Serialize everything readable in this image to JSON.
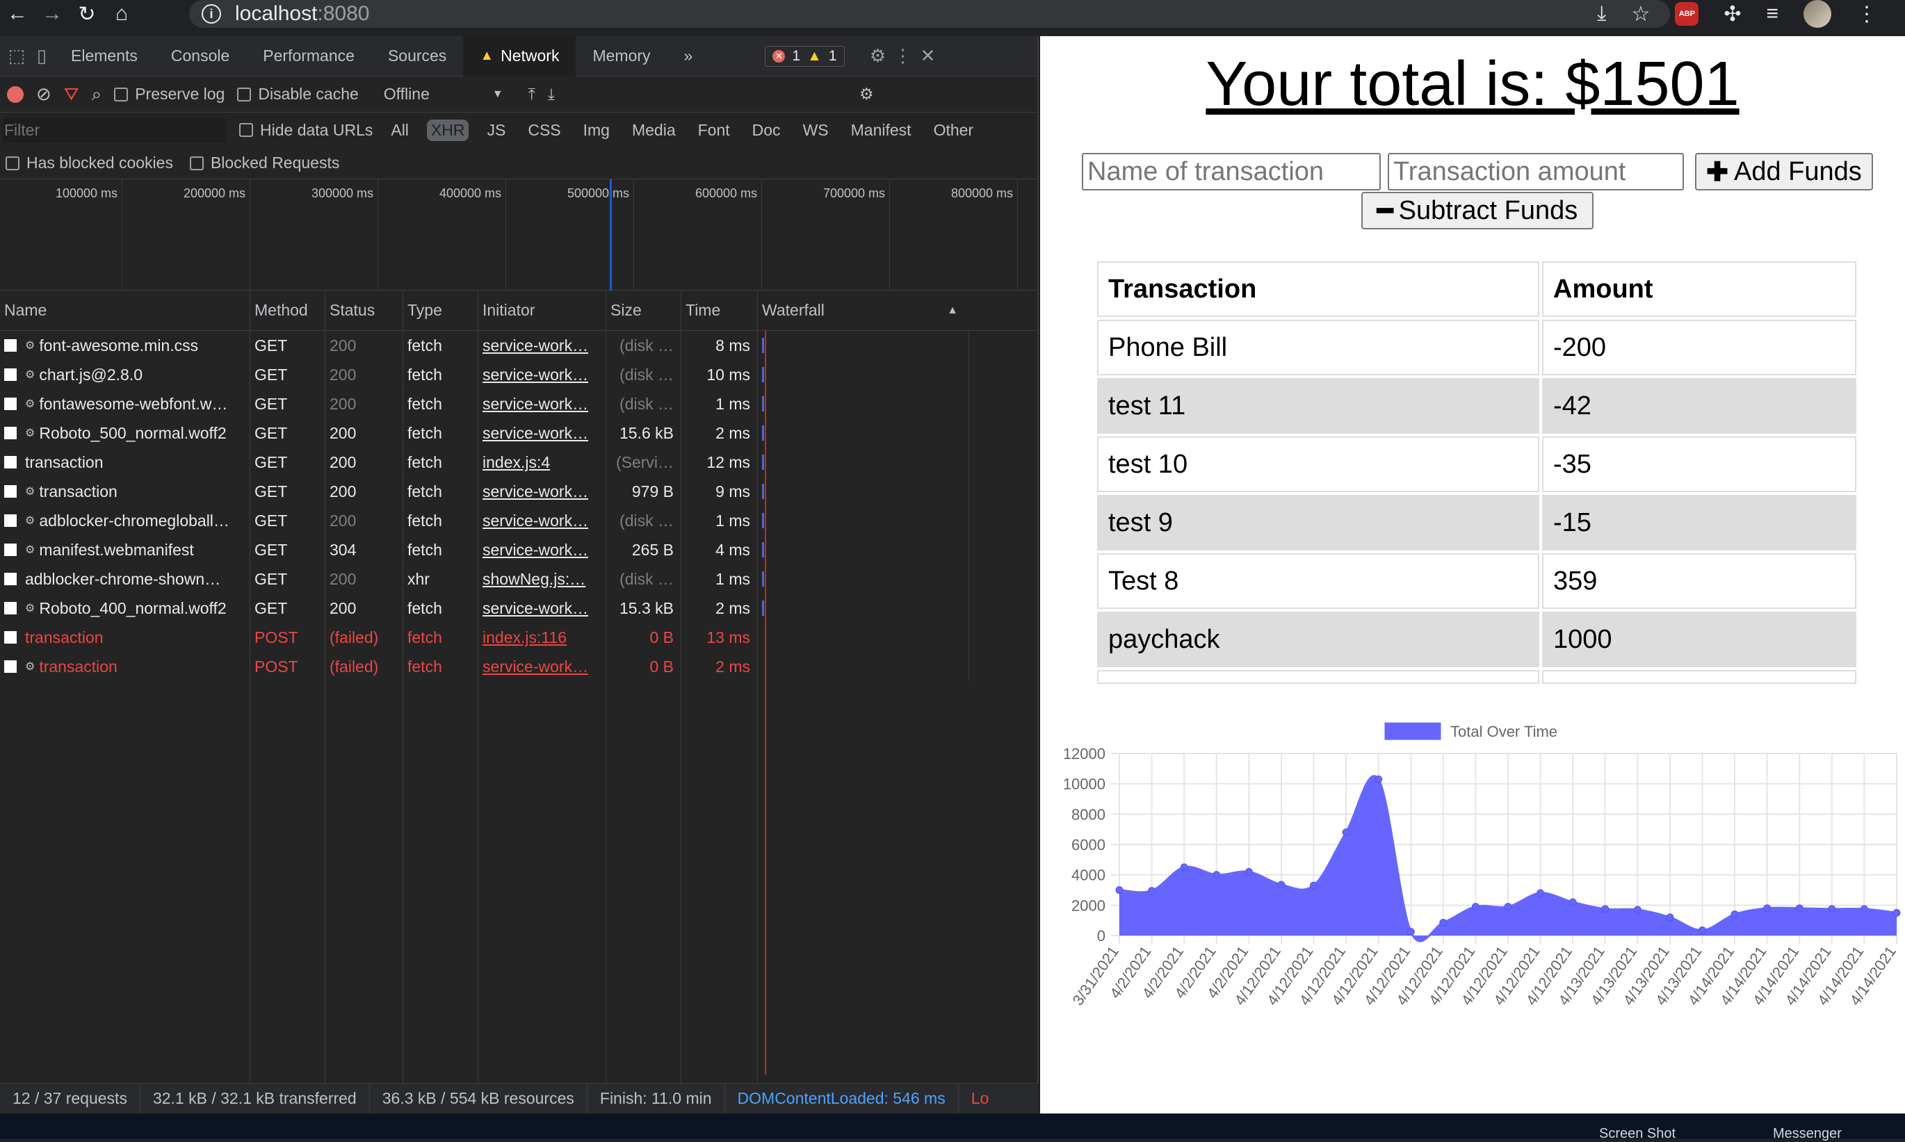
{
  "browser": {
    "url_host": "localhost",
    "url_port": ":8080",
    "nav_icons": [
      "back-icon",
      "forward-icon",
      "reload-icon",
      "home-icon"
    ],
    "ext_badge": "ABP"
  },
  "devtools": {
    "tabs": [
      "Elements",
      "Console",
      "Performance",
      "Sources",
      "Network",
      "Memory"
    ],
    "active_tab": "Network",
    "more": "»",
    "errors": "1",
    "warnings": "1",
    "preserve_log": "Preserve log",
    "disable_cache": "Disable cache",
    "throttle": "Offline",
    "filter_placeholder": "Filter",
    "hide_data_urls": "Hide data URLs",
    "filter_types": [
      "All",
      "XHR",
      "JS",
      "CSS",
      "Img",
      "Media",
      "Font",
      "Doc",
      "WS",
      "Manifest",
      "Other"
    ],
    "active_filter": "XHR",
    "has_blocked_cookies": "Has blocked cookies",
    "blocked_requests": "Blocked Requests",
    "overview_ticks": [
      "100000 ms",
      "200000 ms",
      "300000 ms",
      "400000 ms",
      "500000 ms",
      "600000 ms",
      "700000 ms",
      "800000 ms"
    ],
    "columns": [
      "Name",
      "Method",
      "Status",
      "Type",
      "Initiator",
      "Size",
      "Time",
      "Waterfall"
    ],
    "rows": [
      {
        "name": "font-awesome.min.css",
        "gear": true,
        "method": "GET",
        "status": "200",
        "status_dim": true,
        "type": "fetch",
        "initiator": "service-work…",
        "size": "(disk …",
        "size_dim": true,
        "time": "8 ms",
        "failed": false
      },
      {
        "name": "chart.js@2.8.0",
        "gear": true,
        "method": "GET",
        "status": "200",
        "status_dim": true,
        "type": "fetch",
        "initiator": "service-work…",
        "size": "(disk …",
        "size_dim": true,
        "time": "10 ms",
        "failed": false
      },
      {
        "name": "fontawesome-webfont.w…",
        "gear": true,
        "method": "GET",
        "status": "200",
        "status_dim": true,
        "type": "fetch",
        "initiator": "service-work…",
        "size": "(disk …",
        "size_dim": true,
        "time": "1 ms",
        "failed": false
      },
      {
        "name": "Roboto_500_normal.woff2",
        "gear": true,
        "method": "GET",
        "status": "200",
        "status_dim": false,
        "type": "fetch",
        "initiator": "service-work…",
        "size": "15.6 kB",
        "size_dim": false,
        "time": "2 ms",
        "failed": false
      },
      {
        "name": "transaction",
        "gear": false,
        "method": "GET",
        "status": "200",
        "status_dim": false,
        "type": "fetch",
        "initiator": "index.js:4",
        "size": "(Servi…",
        "size_dim": true,
        "time": "12 ms",
        "failed": false
      },
      {
        "name": "transaction",
        "gear": true,
        "method": "GET",
        "status": "200",
        "status_dim": false,
        "type": "fetch",
        "initiator": "service-work…",
        "size": "979 B",
        "size_dim": false,
        "time": "9 ms",
        "failed": false
      },
      {
        "name": "adblocker-chromegloball…",
        "gear": true,
        "method": "GET",
        "status": "200",
        "status_dim": true,
        "type": "fetch",
        "initiator": "service-work…",
        "size": "(disk …",
        "size_dim": true,
        "time": "1 ms",
        "failed": false
      },
      {
        "name": "manifest.webmanifest",
        "gear": true,
        "method": "GET",
        "status": "304",
        "status_dim": false,
        "type": "fetch",
        "initiator": "service-work…",
        "size": "265 B",
        "size_dim": false,
        "time": "4 ms",
        "failed": false
      },
      {
        "name": "adblocker-chrome-shown…",
        "gear": false,
        "method": "GET",
        "status": "200",
        "status_dim": true,
        "type": "xhr",
        "initiator": "showNeg.js:…",
        "size": "(disk …",
        "size_dim": true,
        "time": "1 ms",
        "failed": false
      },
      {
        "name": "Roboto_400_normal.woff2",
        "gear": true,
        "method": "GET",
        "status": "200",
        "status_dim": false,
        "type": "fetch",
        "initiator": "service-work…",
        "size": "15.3 kB",
        "size_dim": false,
        "time": "2 ms",
        "failed": false
      },
      {
        "name": "transaction",
        "gear": false,
        "method": "POST",
        "status": "(failed)",
        "status_dim": false,
        "type": "fetch",
        "initiator": "index.js:116",
        "size": "0 B",
        "size_dim": false,
        "time": "13 ms",
        "failed": true
      },
      {
        "name": "transaction",
        "gear": true,
        "method": "POST",
        "status": "(failed)",
        "status_dim": false,
        "type": "fetch",
        "initiator": "service-work…",
        "size": "0 B",
        "size_dim": false,
        "time": "2 ms",
        "failed": true
      }
    ],
    "status_bar": {
      "requests": "12 / 37 requests",
      "transferred": "32.1 kB / 32.1 kB transferred",
      "resources": "36.3 kB / 554 kB resources",
      "finish": "Finish: 11.0 min",
      "dcl": "DOMContentLoaded: 546 ms",
      "load": "Lo"
    }
  },
  "page": {
    "total": "Your total is: $1501",
    "name_placeholder": "Name of transaction",
    "amount_placeholder": "Transaction amount",
    "add_label": "Add Funds",
    "subtract_label": "Subtract Funds",
    "table_headers": [
      "Transaction",
      "Amount"
    ],
    "transactions": [
      {
        "name": "Phone Bill",
        "amount": "-200"
      },
      {
        "name": "test 11",
        "amount": "-42"
      },
      {
        "name": "test 10",
        "amount": "-35"
      },
      {
        "name": "test 9",
        "amount": "-15"
      },
      {
        "name": "Test 8",
        "amount": "359"
      },
      {
        "name": "paychack",
        "amount": "1000"
      }
    ]
  },
  "chart_data": {
    "type": "area",
    "legend": "Total Over Time",
    "legend_position": "top",
    "fill_color": "#6666ff",
    "line_color": "#6666ff",
    "ylim": [
      0,
      12000
    ],
    "yticks": [
      0,
      2000,
      4000,
      6000,
      8000,
      10000,
      12000
    ],
    "grid": true,
    "x": [
      "3/31/2021",
      "4/2/2021",
      "4/2/2021",
      "4/2/2021",
      "4/2/2021",
      "4/12/2021",
      "4/12/2021",
      "4/12/2021",
      "4/12/2021",
      "4/12/2021",
      "4/12/2021",
      "4/12/2021",
      "4/12/2021",
      "4/12/2021",
      "4/12/2021",
      "4/13/2021",
      "4/13/2021",
      "4/13/2021",
      "4/13/2021",
      "4/14/2021",
      "4/14/2021",
      "4/14/2021",
      "4/14/2021",
      "4/14/2021",
      "4/14/2021"
    ],
    "values": [
      3000,
      2950,
      4500,
      4000,
      4200,
      3350,
      3300,
      6800,
      10300,
      250,
      850,
      1900,
      1900,
      2800,
      2200,
      1750,
      1700,
      1200,
      350,
      1400,
      1800,
      1800,
      1750,
      1750,
      1500
    ],
    "x_tick_labels": [
      "3/31/2021",
      "4/2/2021",
      "4/2/2021",
      "4/2/2021",
      "4/2/2021",
      "4/12/2021",
      "4/12/2021",
      "4/12/2021",
      "4/12/2021",
      "4/12/2021",
      "4/12/2021",
      "4/12/2021",
      "4/12/2021",
      "4/12/2021",
      "4/12/2021",
      "4/13/2021",
      "4/13/2021",
      "4/13/2021",
      "4/13/2021",
      "4/14/2021",
      "4/14/2021",
      "4/14/2021",
      "4/14/2021",
      "4/14/2021",
      "4/14/2021"
    ]
  },
  "desktop": {
    "labels": [
      "Screen Shot",
      "Messenger"
    ]
  }
}
